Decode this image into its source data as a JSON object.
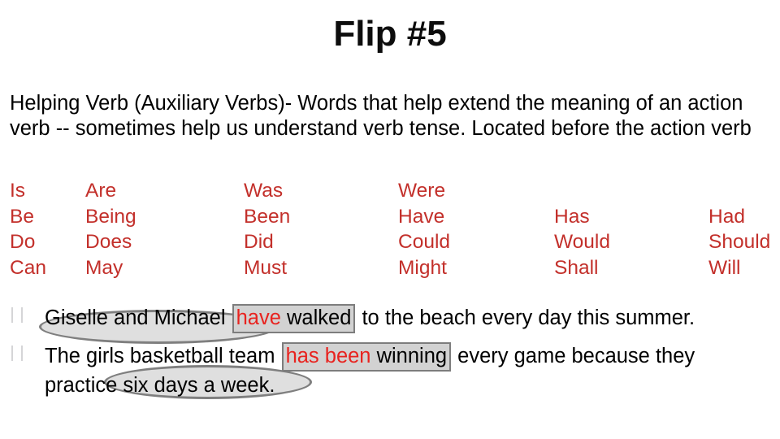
{
  "slide": {
    "title": "Flip #5",
    "definition": "Helping Verb (Auxiliary Verbs)- Words that help extend the meaning of an action verb -- sometimes help us understand verb tense. Located before the action verb",
    "colors": {
      "verb_red": "#c3302b",
      "highlight_red": "#e8231f",
      "box_fill": "#d2d2d2",
      "box_border": "#7d7d7d",
      "ellipse_stroke": "#7f7f7f",
      "text_black": "#000000",
      "background": "#ffffff"
    }
  },
  "verb_grid": {
    "rows": [
      [
        "Is",
        "Are",
        "Was",
        "Were",
        "",
        ""
      ],
      [
        "Be",
        "Being",
        "Been",
        "Have",
        "Has",
        "Had"
      ],
      [
        "Do",
        "Does",
        "Did",
        "Could",
        "Would",
        "Should"
      ],
      [
        "Can",
        "May",
        "Must",
        "Might",
        "Shall",
        "Will"
      ]
    ]
  },
  "examples": {
    "bullet_glyph": "",
    "items": [
      {
        "subject": "Giselle and Michael ",
        "helping_verb": "have",
        "main_verb": " walked",
        "rest": " to the beach every day this summer."
      },
      {
        "subject": "The girls basketball team ",
        "helping_verb": "has been",
        "main_verb": " winning",
        "rest": " every game because they practice six days a week."
      }
    ]
  }
}
